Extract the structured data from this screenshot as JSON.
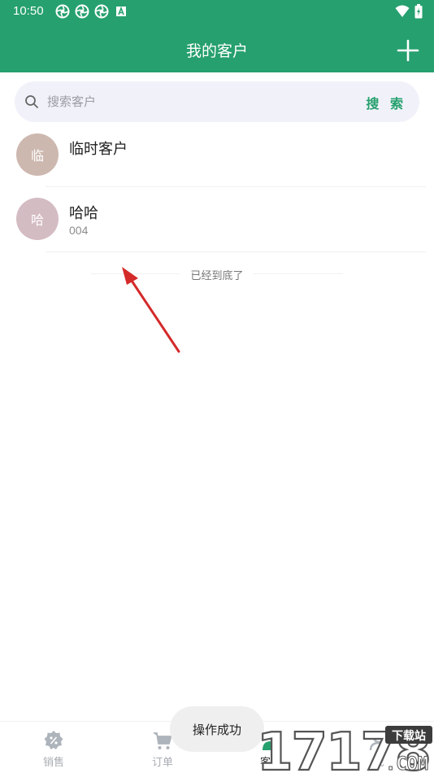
{
  "status_bar": {
    "time": "10:50"
  },
  "header": {
    "title": "我的客户"
  },
  "search": {
    "placeholder": "搜索客户",
    "button_label": "搜 索"
  },
  "customers": [
    {
      "avatar_text": "临",
      "name": "临时客户",
      "code": "",
      "avatar_color": "#cdb8af"
    },
    {
      "avatar_text": "哈",
      "name": "哈哈",
      "code": "004",
      "avatar_color": "#d4bcc3"
    }
  ],
  "list_end_text": "已经到底了",
  "tabs": [
    {
      "label": "销售",
      "icon": "percent-badge-icon"
    },
    {
      "label": "订单",
      "icon": "cart-icon"
    },
    {
      "label": "客户",
      "icon": "person-icon"
    },
    {
      "label": "我",
      "icon": "user-icon"
    }
  ],
  "toast": {
    "text": "操作成功"
  },
  "watermark": {
    "text": "17178",
    "badge": "下载站",
    "sub": ".COM"
  },
  "colors": {
    "brand": "#26a06e",
    "arrow": "#d42a2a"
  }
}
